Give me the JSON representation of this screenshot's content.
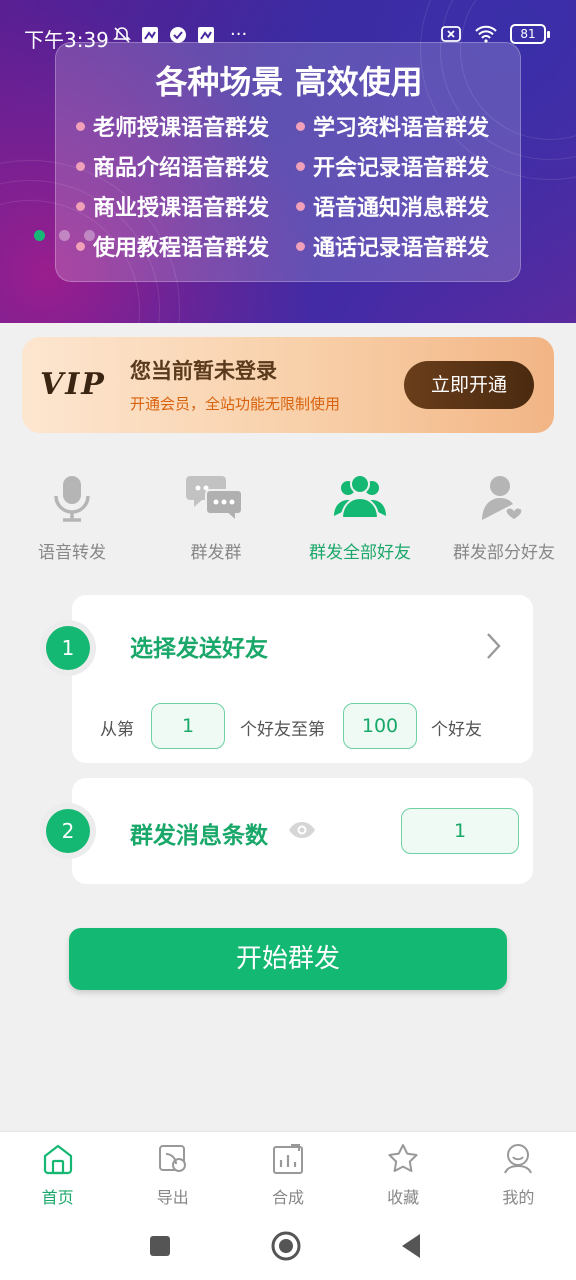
{
  "status_bar": {
    "time": "下午3:39",
    "battery": "81",
    "more": "···"
  },
  "banner": {
    "title": "各种场景 高效使用",
    "features": [
      "老师授课语音群发",
      "学习资料语音群发",
      "商品介绍语音群发",
      "开会记录语音群发",
      "商业授课语音群发",
      "语音通知消息群发",
      "使用教程语音群发",
      "通话记录语音群发"
    ],
    "carousel_active_index": 0
  },
  "vip": {
    "logo": "VIP",
    "title": "您当前暂未登录",
    "subtitle": "开通会员，全站功能无限制使用",
    "button": "立即开通"
  },
  "tabs": [
    {
      "label": "语音转发",
      "icon": "microphone-icon"
    },
    {
      "label": "群发群",
      "icon": "chat-bubbles-icon"
    },
    {
      "label": "群发全部好友",
      "icon": "group-icon"
    },
    {
      "label": "群发部分好友",
      "icon": "person-heart-icon"
    }
  ],
  "tabs_active_index": 2,
  "select_friends": {
    "step": "1",
    "title": "选择发送好友",
    "from_label": "从第",
    "from_value": "1",
    "mid_label": "个好友至第",
    "to_value": "100",
    "end_label": "个好友"
  },
  "message_count": {
    "step": "2",
    "title": "群发消息条数",
    "value": "1"
  },
  "start_button": "开始群发",
  "bottom_nav": [
    {
      "label": "首页",
      "icon": "home-icon"
    },
    {
      "label": "导出",
      "icon": "export-icon"
    },
    {
      "label": "合成",
      "icon": "compose-icon"
    },
    {
      "label": "收藏",
      "icon": "star-icon"
    },
    {
      "label": "我的",
      "icon": "profile-icon"
    }
  ],
  "bottom_nav_active_index": 0,
  "colors": {
    "accent": "#13b873",
    "vip_button": "#5a3415",
    "banner": "#4a2aa0"
  }
}
